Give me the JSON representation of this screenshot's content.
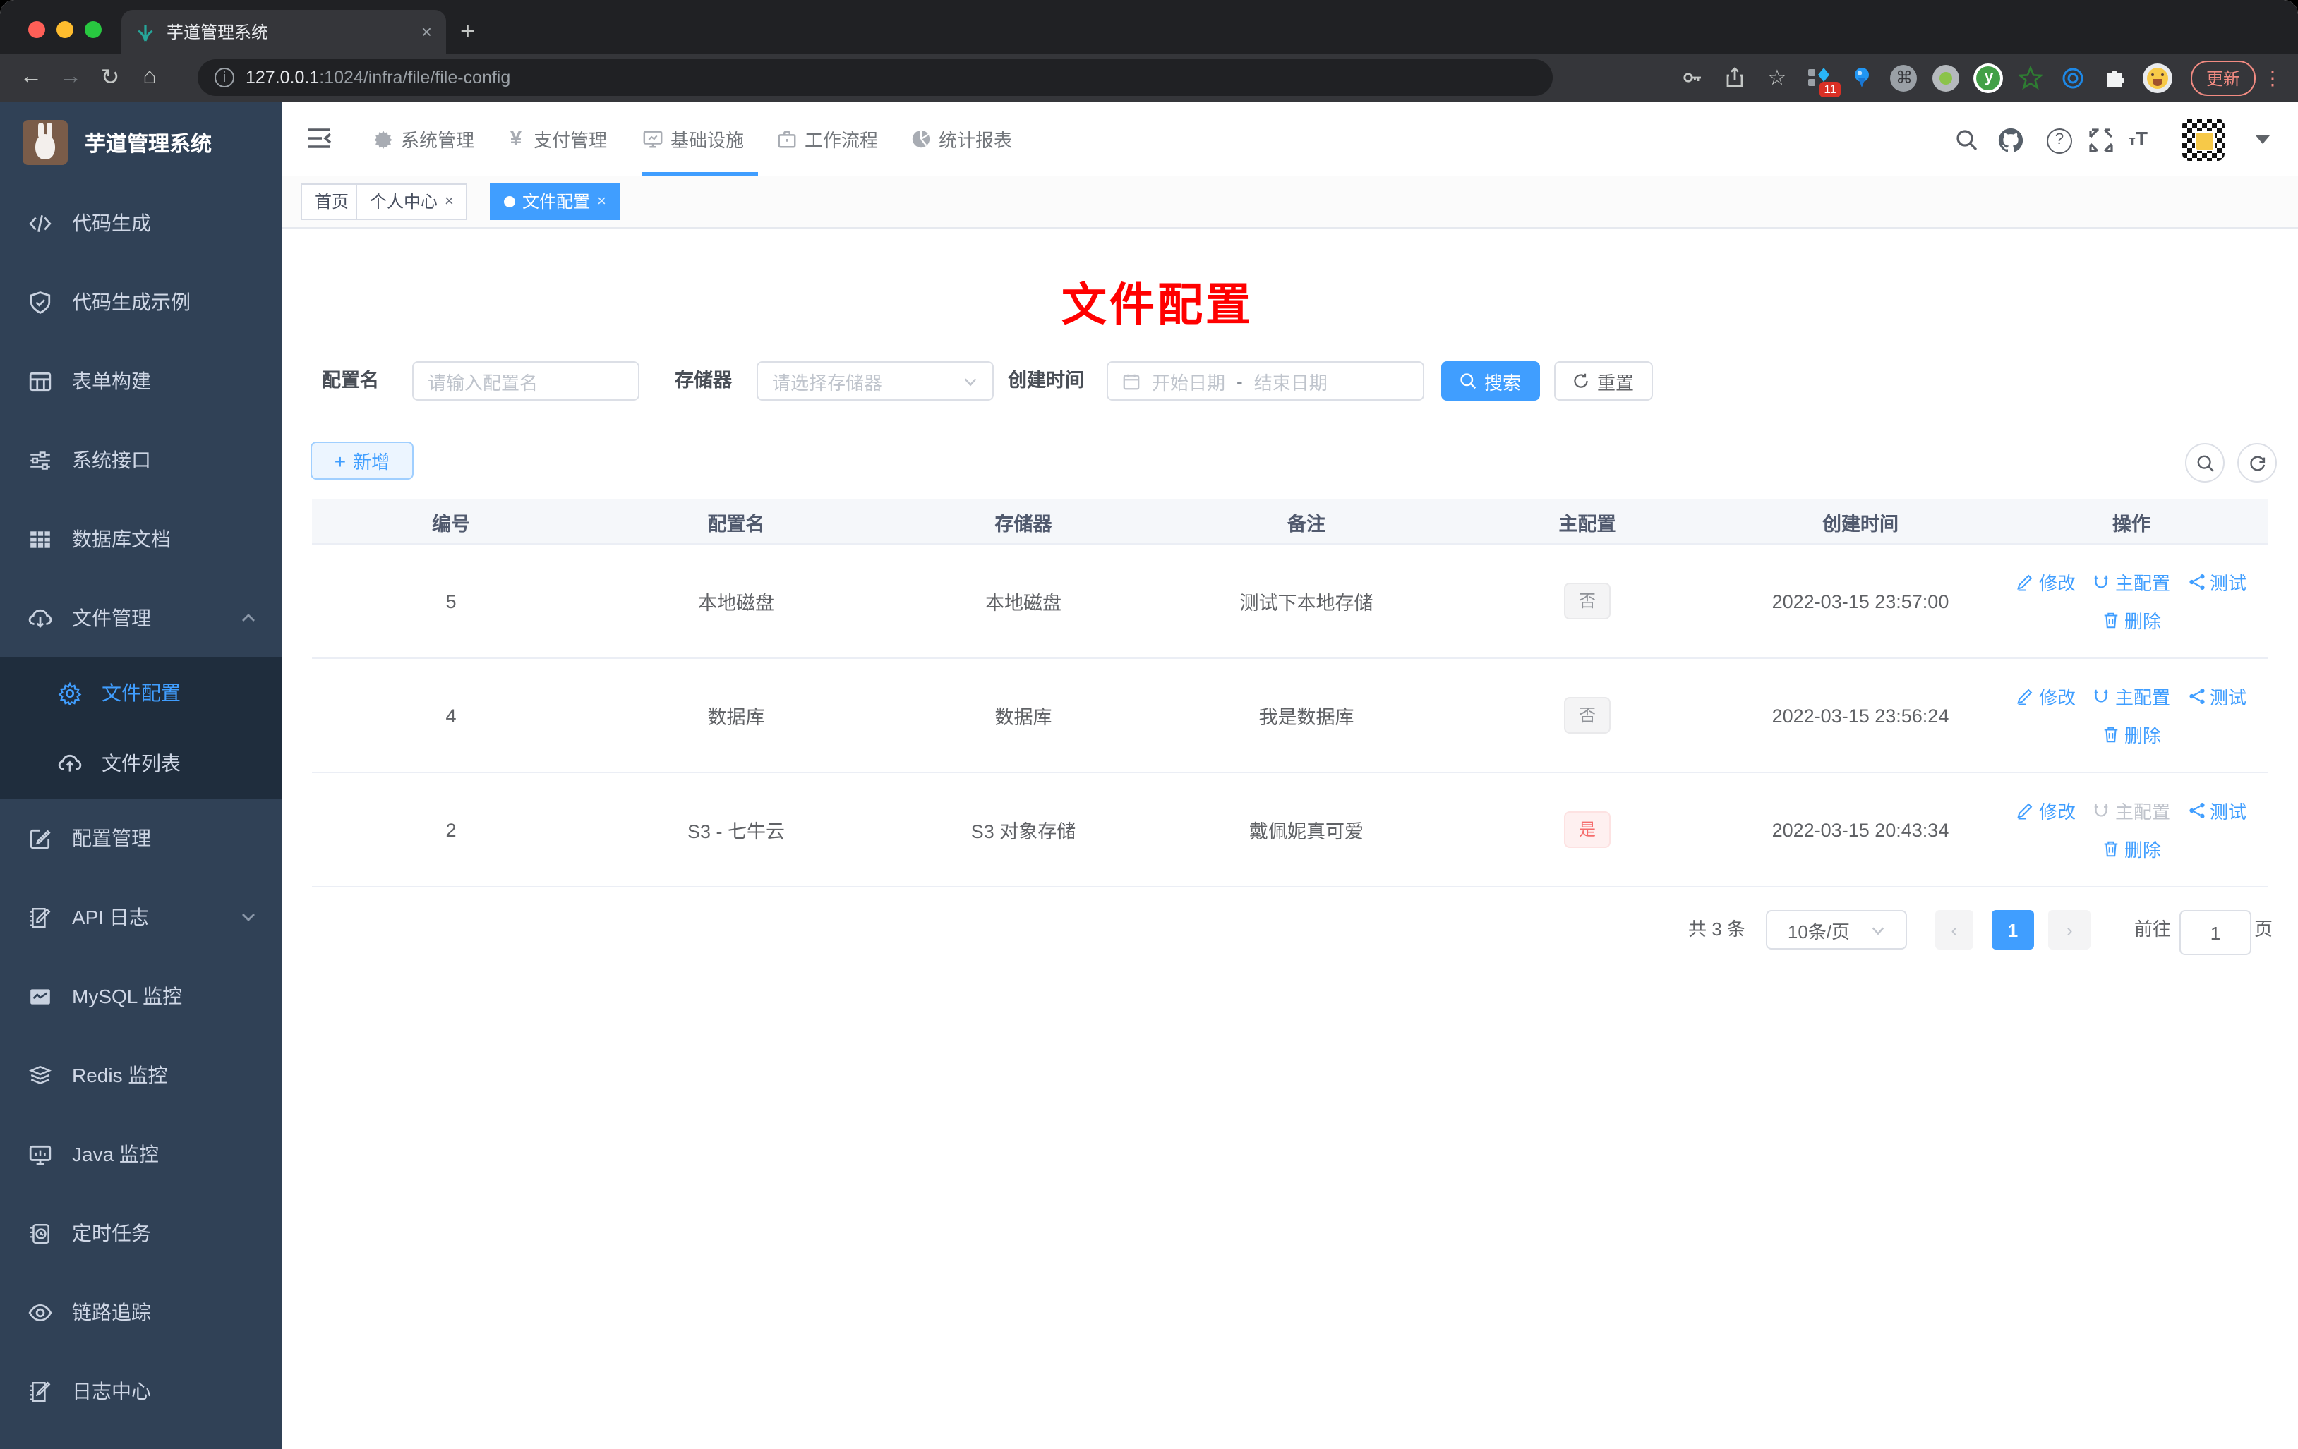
{
  "browser": {
    "tab_title": "芋道管理系统",
    "new_tab": "+",
    "close_tab": "×",
    "url_host": "127.0.0.1",
    "url_path": ":1024/infra/file/file-config",
    "update_label": "更新",
    "extension_badge": "11"
  },
  "sidebar": {
    "title": "芋道管理系统",
    "items": [
      {
        "icon": "code-icon",
        "label": "代码生成"
      },
      {
        "icon": "shield-check-icon",
        "label": "代码生成示例"
      },
      {
        "icon": "form-grid-icon",
        "label": "表单构建"
      },
      {
        "icon": "sliders-icon",
        "label": "系统接口"
      },
      {
        "icon": "table-icon",
        "label": "数据库文档"
      },
      {
        "icon": "cloud-download-icon",
        "label": "文件管理"
      },
      {
        "icon": "gear-icon",
        "label": "文件配置",
        "active": true
      },
      {
        "icon": "cloud-upload-icon",
        "label": "文件列表"
      },
      {
        "icon": "edit-square-icon",
        "label": "配置管理"
      },
      {
        "icon": "doc-edit-icon",
        "label": "API 日志"
      },
      {
        "icon": "chart-board-icon",
        "label": "MySQL 监控"
      },
      {
        "icon": "layers-icon",
        "label": "Redis 监控"
      },
      {
        "icon": "monitor-icon",
        "label": "Java 监控"
      },
      {
        "icon": "timer-icon",
        "label": "定时任务"
      },
      {
        "icon": "eye-icon",
        "label": "链路追踪"
      },
      {
        "icon": "log-edit-icon",
        "label": "日志中心"
      }
    ]
  },
  "topnav": {
    "items": [
      {
        "icon": "gear-icon",
        "label": "系统管理"
      },
      {
        "icon": "yen-icon",
        "label": "支付管理"
      },
      {
        "icon": "monitor-icon",
        "label": "基础设施",
        "active": true
      },
      {
        "icon": "briefcase-icon",
        "label": "工作流程"
      },
      {
        "icon": "pie-chart-icon",
        "label": "统计报表"
      }
    ]
  },
  "tags": [
    {
      "label": "首页"
    },
    {
      "label": "个人中心",
      "closable": true
    },
    {
      "label": "文件配置",
      "active": true,
      "closable": true
    }
  ],
  "annotation": {
    "text": "文件配置",
    "color": "#ff0000"
  },
  "filters": {
    "name_label": "配置名",
    "name_placeholder": "请输入配置名",
    "storage_label": "存储器",
    "storage_placeholder": "请选择存储器",
    "date_label": "创建时间",
    "date_start_placeholder": "开始日期",
    "date_separator": "-",
    "date_end_placeholder": "结束日期",
    "search_label": "搜索",
    "reset_label": "重置"
  },
  "toolbar": {
    "add_label": "新增"
  },
  "table": {
    "columns": [
      "编号",
      "配置名",
      "存储器",
      "备注",
      "主配置",
      "创建时间",
      "操作"
    ],
    "rows": [
      {
        "id": "5",
        "name": "本地磁盘",
        "storage": "本地磁盘",
        "remark": "测试下本地存储",
        "master": "否",
        "created": "2022-03-15 23:57:00"
      },
      {
        "id": "4",
        "name": "数据库",
        "storage": "数据库",
        "remark": "我是数据库",
        "master": "否",
        "created": "2022-03-15 23:56:24"
      },
      {
        "id": "2",
        "name": "S3 - 七牛云",
        "storage": "S3 对象存储",
        "remark": "戴佩妮真可爱",
        "master": "是",
        "created": "2022-03-15 20:43:34"
      }
    ]
  },
  "actions": {
    "edit": "修改",
    "master": "主配置",
    "test": "测试",
    "remove": "删除"
  },
  "pagination": {
    "total": "共 3 条",
    "page_size": "10条/页",
    "prev": "‹",
    "current": "1",
    "next": "›",
    "goto_label": "前往",
    "goto_value": "1",
    "unit": "页"
  },
  "colors": {
    "accent": "#409eff",
    "sidebar_bg": "#304156",
    "submenu_bg": "#1f2d3d",
    "danger": "#f56c6c"
  }
}
